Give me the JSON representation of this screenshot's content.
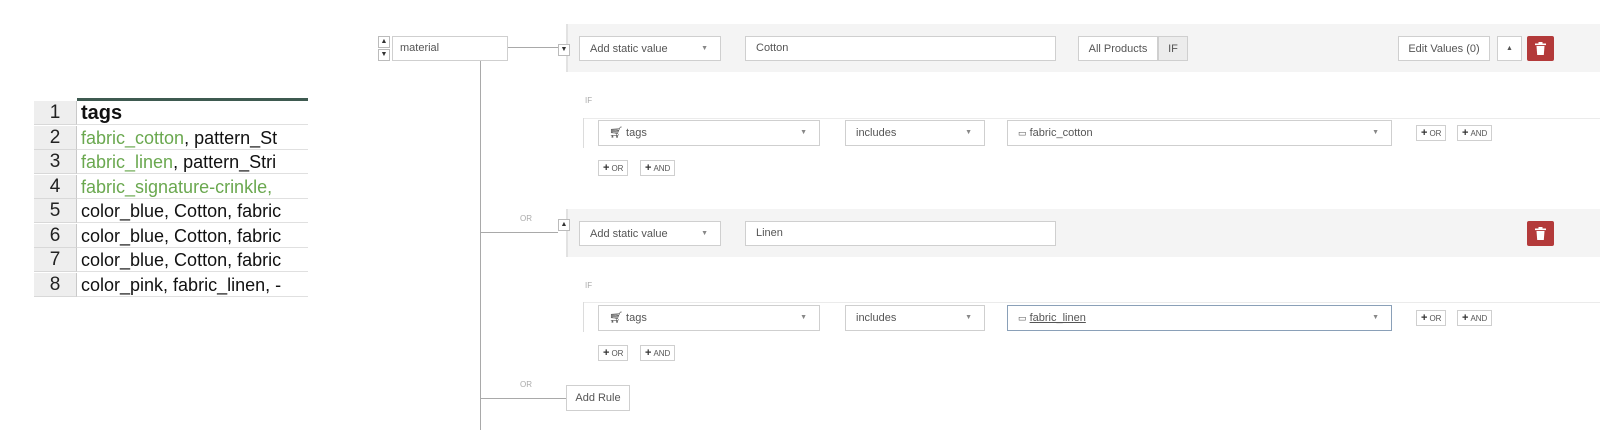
{
  "spreadsheet": {
    "rows": [
      {
        "num": "1",
        "cells": [
          {
            "text": "tags",
            "green": false
          }
        ]
      },
      {
        "num": "2",
        "cells": [
          {
            "text": "fabric_cotton",
            "green": true
          },
          {
            "text": ", pattern_St",
            "green": false
          }
        ]
      },
      {
        "num": "3",
        "cells": [
          {
            "text": "fabric_linen",
            "green": true
          },
          {
            "text": ", pattern_Stri",
            "green": false
          }
        ]
      },
      {
        "num": "4",
        "cells": [
          {
            "text": "fabric_signature-crinkle,",
            "green": true
          }
        ]
      },
      {
        "num": "5",
        "cells": [
          {
            "text": "color_blue, Cotton, fabric",
            "green": false
          }
        ]
      },
      {
        "num": "6",
        "cells": [
          {
            "text": "color_blue, Cotton, fabric",
            "green": false
          }
        ]
      },
      {
        "num": "7",
        "cells": [
          {
            "text": "color_blue, Cotton, fabric",
            "green": false
          }
        ]
      },
      {
        "num": "8",
        "cells": [
          {
            "text": "color_pink, fabric_linen, -",
            "green": false
          }
        ]
      }
    ]
  },
  "rule_builder": {
    "field_name": "material",
    "or_label": "OR",
    "if_label": "IF",
    "add_rule_label": "Add Rule",
    "rules": [
      {
        "source_select": "Add static value",
        "value": "Cotton",
        "all_products_label": "All Products",
        "if_toggle_label": "IF",
        "edit_values_label": "Edit Values (0)",
        "condition": {
          "attribute": "tags",
          "operator": "includes",
          "match": "fabric_cotton"
        }
      },
      {
        "source_select": "Add static value",
        "value": "Linen",
        "condition": {
          "attribute": "tags",
          "operator": "includes",
          "match": "fabric_linen"
        }
      }
    ],
    "or_button": "OR",
    "and_button": "AND"
  },
  "colors": {
    "accent_green": "#6aa84f",
    "delete_red": "#b33a3a",
    "header_rule": "#3e5a50"
  }
}
